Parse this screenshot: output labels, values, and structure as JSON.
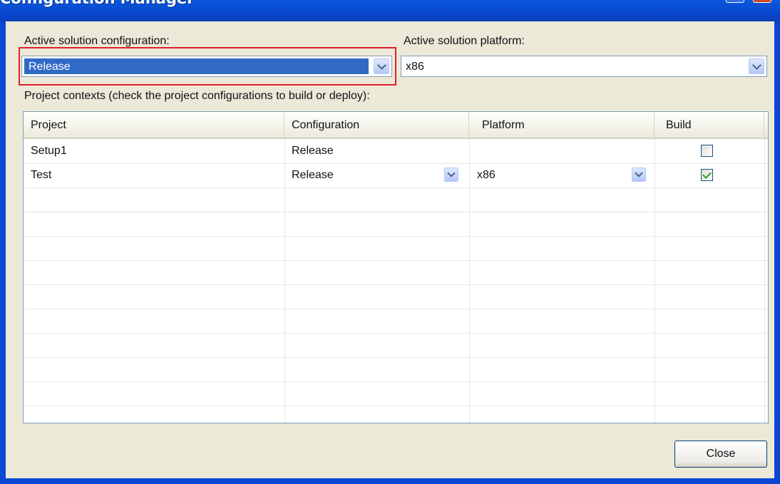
{
  "window": {
    "title": "Configuration Manager"
  },
  "title_buttons": {
    "help": "?",
    "close": "✕"
  },
  "config": {
    "label": "Active solution configuration:",
    "value": "Release"
  },
  "platform": {
    "label": "Active solution platform:",
    "value": "x86"
  },
  "contexts_label": "Project contexts (check the project configurations to build or deploy):",
  "table": {
    "headers": [
      "Project",
      "Configuration",
      "Platform",
      "Build"
    ],
    "rows": [
      {
        "project": "Setup1",
        "configuration": "Release",
        "platform": "",
        "build": false
      },
      {
        "project": "Test",
        "configuration": "Release",
        "platform": "x86",
        "build": true
      }
    ]
  },
  "buttons": {
    "close": "Close"
  },
  "colors": {
    "highlight": "#E0202A",
    "titlebar": "#0A5BE0",
    "selection": "#316AC5"
  }
}
